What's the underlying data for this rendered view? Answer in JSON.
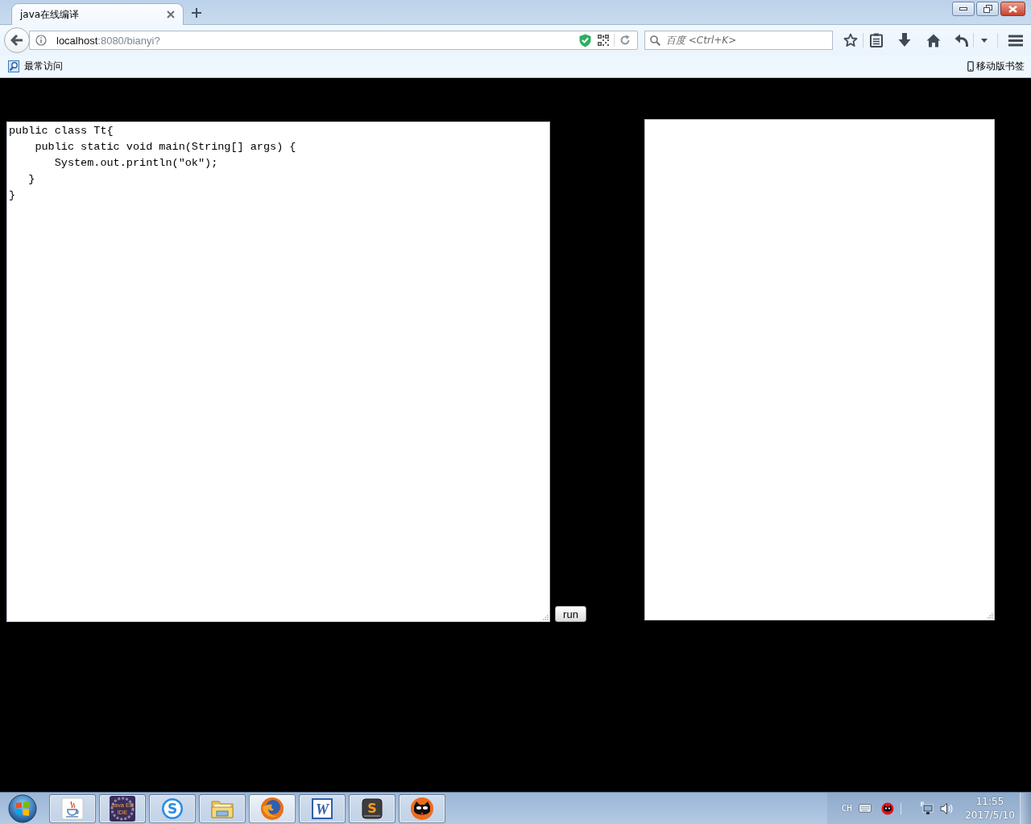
{
  "tabs": [
    {
      "title": "java在线编译",
      "selected": true
    }
  ],
  "address_bar": {
    "host": "localhost",
    "path": ":8080/bianyi?"
  },
  "search": {
    "placeholder": "百度 <Ctrl+K>"
  },
  "bookmarks_bar": {
    "most_visited": "最常访问",
    "mobile_bookmarks": "移动版书签"
  },
  "page": {
    "code_editor": {
      "lines": [
        "public class Tt{",
        "    public static void main(String[] args) {",
        "       System.out.println(\"ok\");",
        "   }",
        "}"
      ]
    },
    "run_button": {
      "label": "run"
    }
  },
  "taskbar": {
    "apps": [
      {
        "kind": "java",
        "selected": false
      },
      {
        "kind": "eclipse",
        "glyph_lines": [
          "Java EE",
          "IDE"
        ],
        "selected": false
      },
      {
        "kind": "sogou",
        "glyph": "S",
        "selected": false
      },
      {
        "kind": "explorer",
        "selected": false
      },
      {
        "kind": "firefox",
        "selected": true
      },
      {
        "kind": "word",
        "glyph": "W",
        "selected": false
      },
      {
        "kind": "sublime",
        "glyph": "S",
        "selected": false
      },
      {
        "kind": "kk",
        "selected": false
      }
    ],
    "tray": {
      "language": "CH",
      "time": "11:55",
      "date": "2017/5/10"
    }
  }
}
